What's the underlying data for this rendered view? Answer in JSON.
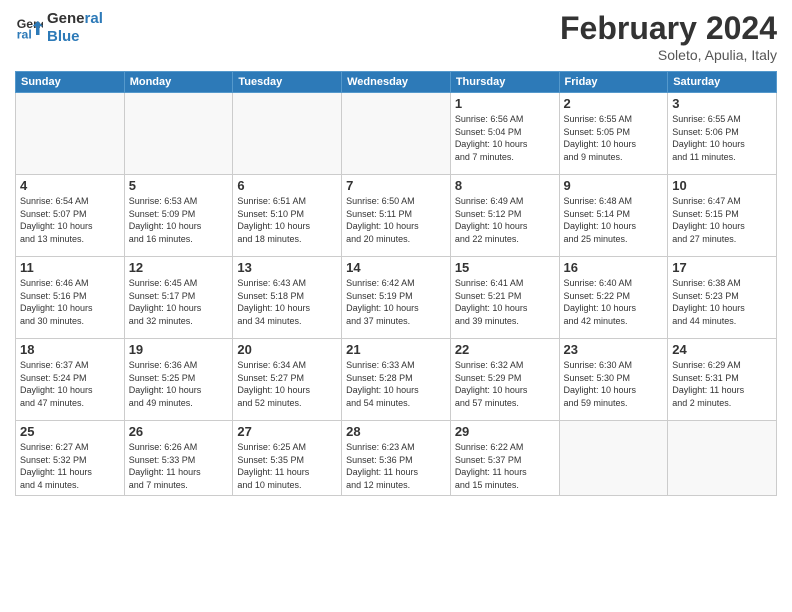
{
  "logo": {
    "line1": "General",
    "line2": "Blue"
  },
  "title": "February 2024",
  "subtitle": "Soleto, Apulia, Italy",
  "days_of_week": [
    "Sunday",
    "Monday",
    "Tuesday",
    "Wednesday",
    "Thursday",
    "Friday",
    "Saturday"
  ],
  "weeks": [
    [
      {
        "day": "",
        "info": ""
      },
      {
        "day": "",
        "info": ""
      },
      {
        "day": "",
        "info": ""
      },
      {
        "day": "",
        "info": ""
      },
      {
        "day": "1",
        "info": "Sunrise: 6:56 AM\nSunset: 5:04 PM\nDaylight: 10 hours\nand 7 minutes."
      },
      {
        "day": "2",
        "info": "Sunrise: 6:55 AM\nSunset: 5:05 PM\nDaylight: 10 hours\nand 9 minutes."
      },
      {
        "day": "3",
        "info": "Sunrise: 6:55 AM\nSunset: 5:06 PM\nDaylight: 10 hours\nand 11 minutes."
      }
    ],
    [
      {
        "day": "4",
        "info": "Sunrise: 6:54 AM\nSunset: 5:07 PM\nDaylight: 10 hours\nand 13 minutes."
      },
      {
        "day": "5",
        "info": "Sunrise: 6:53 AM\nSunset: 5:09 PM\nDaylight: 10 hours\nand 16 minutes."
      },
      {
        "day": "6",
        "info": "Sunrise: 6:51 AM\nSunset: 5:10 PM\nDaylight: 10 hours\nand 18 minutes."
      },
      {
        "day": "7",
        "info": "Sunrise: 6:50 AM\nSunset: 5:11 PM\nDaylight: 10 hours\nand 20 minutes."
      },
      {
        "day": "8",
        "info": "Sunrise: 6:49 AM\nSunset: 5:12 PM\nDaylight: 10 hours\nand 22 minutes."
      },
      {
        "day": "9",
        "info": "Sunrise: 6:48 AM\nSunset: 5:14 PM\nDaylight: 10 hours\nand 25 minutes."
      },
      {
        "day": "10",
        "info": "Sunrise: 6:47 AM\nSunset: 5:15 PM\nDaylight: 10 hours\nand 27 minutes."
      }
    ],
    [
      {
        "day": "11",
        "info": "Sunrise: 6:46 AM\nSunset: 5:16 PM\nDaylight: 10 hours\nand 30 minutes."
      },
      {
        "day": "12",
        "info": "Sunrise: 6:45 AM\nSunset: 5:17 PM\nDaylight: 10 hours\nand 32 minutes."
      },
      {
        "day": "13",
        "info": "Sunrise: 6:43 AM\nSunset: 5:18 PM\nDaylight: 10 hours\nand 34 minutes."
      },
      {
        "day": "14",
        "info": "Sunrise: 6:42 AM\nSunset: 5:19 PM\nDaylight: 10 hours\nand 37 minutes."
      },
      {
        "day": "15",
        "info": "Sunrise: 6:41 AM\nSunset: 5:21 PM\nDaylight: 10 hours\nand 39 minutes."
      },
      {
        "day": "16",
        "info": "Sunrise: 6:40 AM\nSunset: 5:22 PM\nDaylight: 10 hours\nand 42 minutes."
      },
      {
        "day": "17",
        "info": "Sunrise: 6:38 AM\nSunset: 5:23 PM\nDaylight: 10 hours\nand 44 minutes."
      }
    ],
    [
      {
        "day": "18",
        "info": "Sunrise: 6:37 AM\nSunset: 5:24 PM\nDaylight: 10 hours\nand 47 minutes."
      },
      {
        "day": "19",
        "info": "Sunrise: 6:36 AM\nSunset: 5:25 PM\nDaylight: 10 hours\nand 49 minutes."
      },
      {
        "day": "20",
        "info": "Sunrise: 6:34 AM\nSunset: 5:27 PM\nDaylight: 10 hours\nand 52 minutes."
      },
      {
        "day": "21",
        "info": "Sunrise: 6:33 AM\nSunset: 5:28 PM\nDaylight: 10 hours\nand 54 minutes."
      },
      {
        "day": "22",
        "info": "Sunrise: 6:32 AM\nSunset: 5:29 PM\nDaylight: 10 hours\nand 57 minutes."
      },
      {
        "day": "23",
        "info": "Sunrise: 6:30 AM\nSunset: 5:30 PM\nDaylight: 10 hours\nand 59 minutes."
      },
      {
        "day": "24",
        "info": "Sunrise: 6:29 AM\nSunset: 5:31 PM\nDaylight: 11 hours\nand 2 minutes."
      }
    ],
    [
      {
        "day": "25",
        "info": "Sunrise: 6:27 AM\nSunset: 5:32 PM\nDaylight: 11 hours\nand 4 minutes."
      },
      {
        "day": "26",
        "info": "Sunrise: 6:26 AM\nSunset: 5:33 PM\nDaylight: 11 hours\nand 7 minutes."
      },
      {
        "day": "27",
        "info": "Sunrise: 6:25 AM\nSunset: 5:35 PM\nDaylight: 11 hours\nand 10 minutes."
      },
      {
        "day": "28",
        "info": "Sunrise: 6:23 AM\nSunset: 5:36 PM\nDaylight: 11 hours\nand 12 minutes."
      },
      {
        "day": "29",
        "info": "Sunrise: 6:22 AM\nSunset: 5:37 PM\nDaylight: 11 hours\nand 15 minutes."
      },
      {
        "day": "",
        "info": ""
      },
      {
        "day": "",
        "info": ""
      }
    ]
  ]
}
